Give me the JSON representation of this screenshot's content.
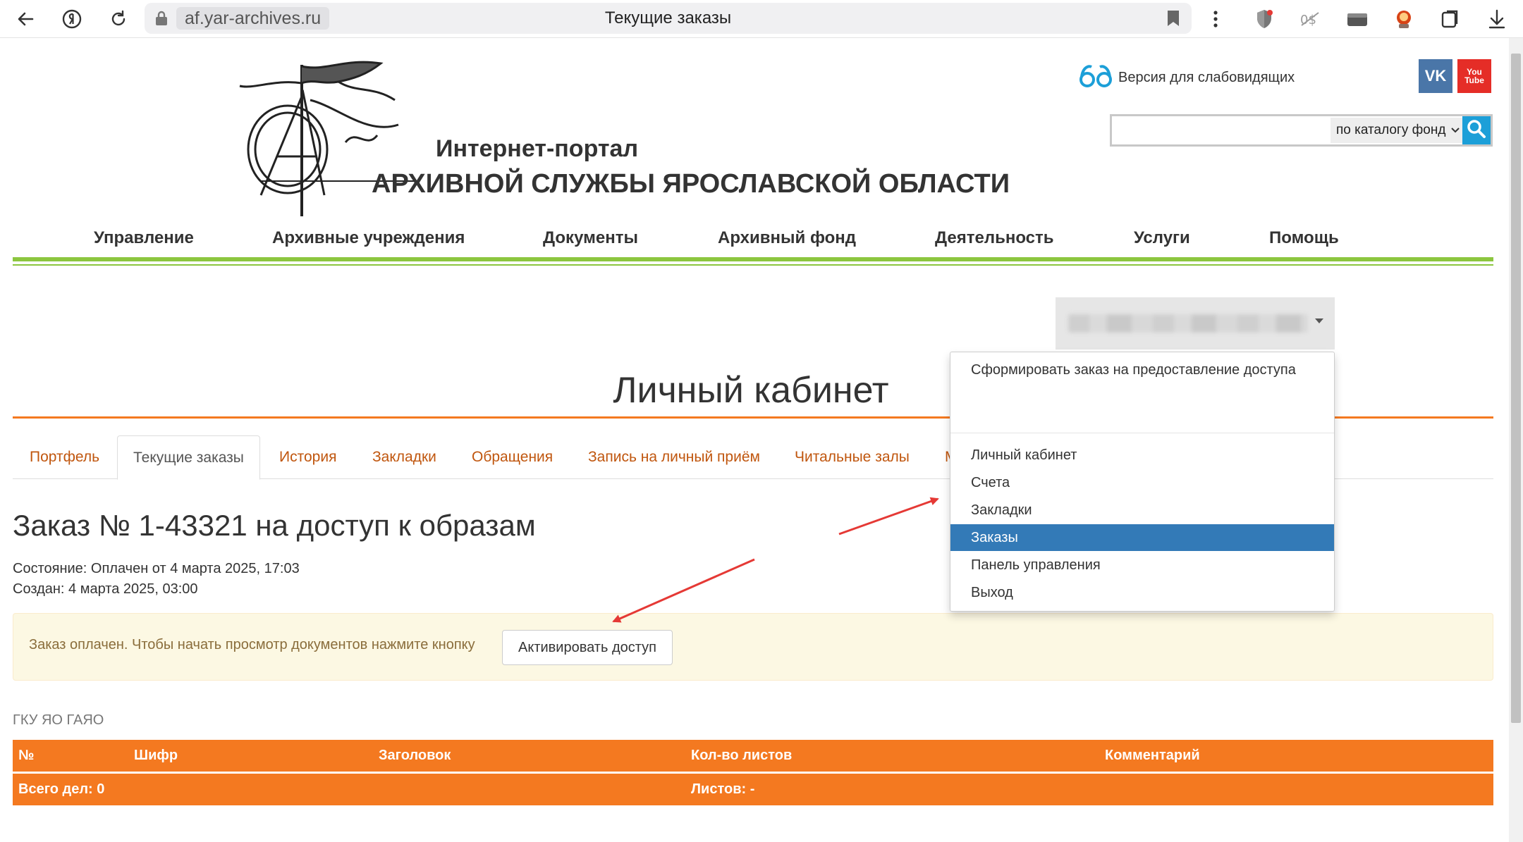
{
  "browser": {
    "domain": "af.yar-archives.ru",
    "tab_title": "Текущие заказы"
  },
  "header": {
    "portal_line1": "Интернет-портал",
    "portal_line2": "АРХИВНОЙ СЛУЖБЫ ЯРОСЛАВСКОЙ ОБЛАСТИ",
    "vision_label": "Версия для слабовидящих",
    "vk_label": "VK",
    "yt_label_1": "You",
    "yt_label_2": "Tube",
    "search_value": "",
    "search_scope": "по каталогу фонд"
  },
  "nav": {
    "items": [
      "Управление",
      "Архивные учреждения",
      "Документы",
      "Архивный фонд",
      "Деятельность",
      "Услуги",
      "Помощь"
    ]
  },
  "cabinet": {
    "title": "Личный кабинет"
  },
  "tabs": [
    "Портфель",
    "Текущие заказы",
    "История",
    "Закладки",
    "Обращения",
    "Запись на личный приём",
    "Читальные залы",
    "М"
  ],
  "order": {
    "title": "Заказ № 1-43321 на доступ к образам",
    "status": "Состояние: Оплачен от 4 марта 2025, 17:03",
    "created": "Создан: 4 марта 2025, 03:00",
    "alert_text": "Заказ оплачен. Чтобы начать просмотр документов нажмите кнопку",
    "activate_button": "Активировать доступ",
    "org": "ГКУ ЯО ГАЯО"
  },
  "table": {
    "columns": [
      "№",
      "Шифр",
      "Заголовок",
      "Кол-во листов",
      "Комментарий"
    ],
    "total_cases": "Всего дел: 0",
    "total_sheets": "Листов: -"
  },
  "user_menu": {
    "first": "Сформировать заказ на предоставление доступа",
    "items": [
      "Личный кабинет",
      "Счета",
      "Закладки",
      "Заказы",
      "Панель управления",
      "Выход"
    ],
    "active_index": 3
  },
  "colors": {
    "orange": "#f47920",
    "green": "#8cc63f",
    "menu_active": "#337ab7",
    "annotation_arrow": "#e53935"
  }
}
